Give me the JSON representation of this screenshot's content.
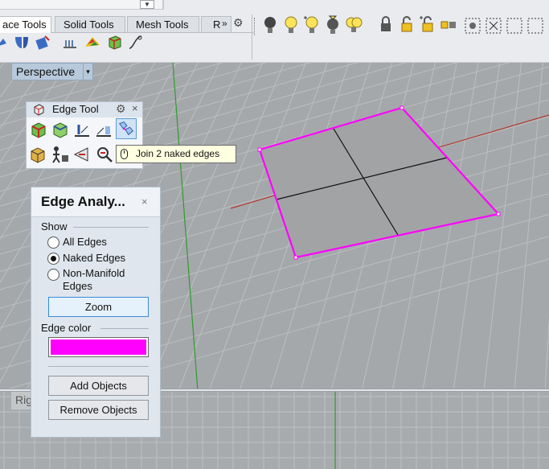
{
  "toolbar": {
    "tabs": [
      {
        "label": "ace Tools",
        "active": true
      },
      {
        "label": "Solid Tools",
        "active": false
      },
      {
        "label": "Mesh Tools",
        "active": false
      },
      {
        "label": "R",
        "active": false
      }
    ],
    "more_glyph": "»",
    "gear_glyph": "⚙"
  },
  "viewport": {
    "title": "Perspective",
    "dropdown_glyph": "▾",
    "bottom_title": "Rig"
  },
  "edge_tools": {
    "title": "Edge Tool",
    "gear_glyph": "⚙",
    "close_glyph": "×",
    "tooltip": "Join 2 naked edges"
  },
  "edge_analysis": {
    "title": "Edge Analy...",
    "close_glyph": "×",
    "show_label": "Show",
    "options": [
      {
        "label": "All Edges",
        "selected": false
      },
      {
        "label": "Naked Edges",
        "selected": true
      },
      {
        "label": "Non-Manifold\nEdges",
        "selected": false
      }
    ],
    "opt_all": "All Edges",
    "opt_naked": "Naked Edges",
    "opt_nonmanifold_1": "Non-Manifold",
    "opt_nonmanifold_2": "Edges",
    "zoom_label": "Zoom",
    "edge_color_label": "Edge color",
    "edge_color": "#ff00ff",
    "add_label": "Add Objects",
    "remove_label": "Remove Objects"
  },
  "colors": {
    "naked_edge": "#ff00ff",
    "x_axis": "#b33a2e",
    "y_axis": "#2f9a2f",
    "surface": "#a2a3a4"
  }
}
